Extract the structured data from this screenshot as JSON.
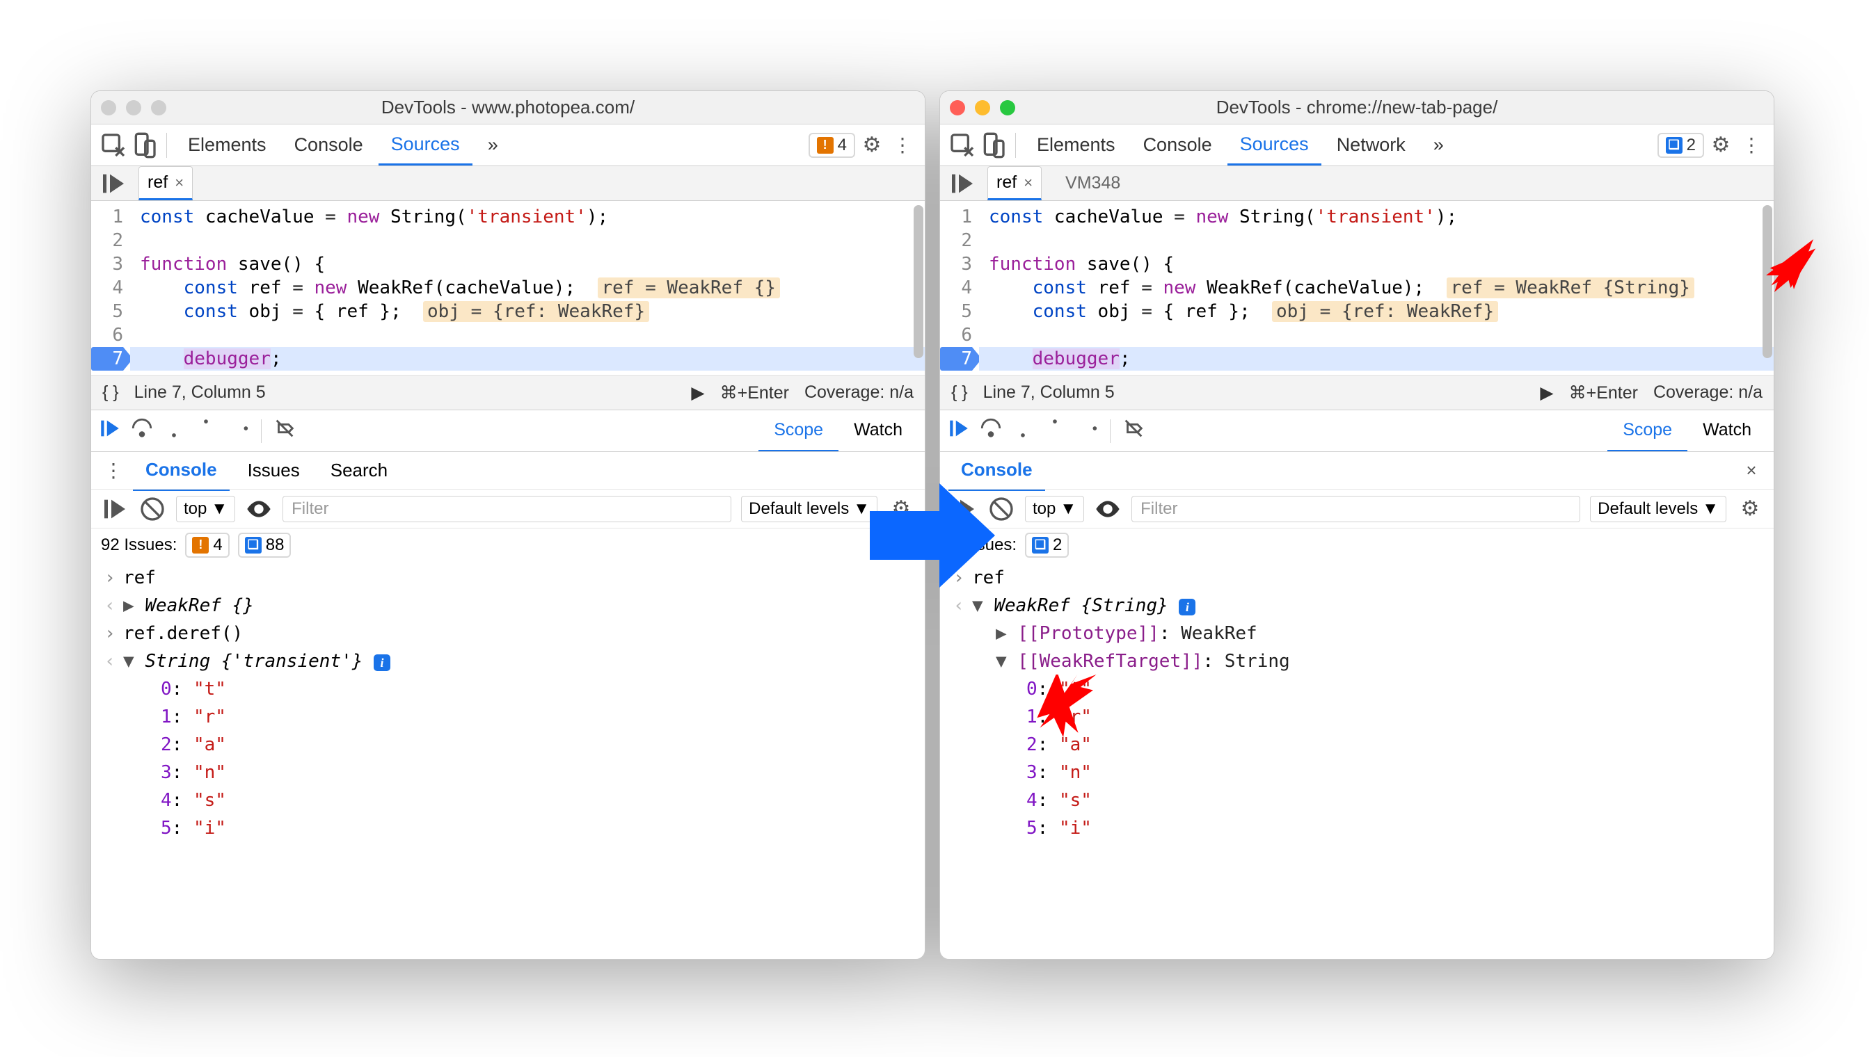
{
  "left": {
    "title": "DevTools - www.photopea.com/",
    "traffic_active": false,
    "maintabs": {
      "elements": "Elements",
      "console": "Console",
      "sources": "Sources"
    },
    "badge_warn": "4",
    "src_tab_active": "ref",
    "cursor": "Line 7, Column 5",
    "run_hint": "⌘+Enter",
    "coverage": "Coverage: n/a",
    "scope_tab": "Scope",
    "watch_tab": "Watch",
    "drawer": {
      "console": "Console",
      "issues": "Issues",
      "search": "Search"
    },
    "console_ctx": "top",
    "filter_ph": "Filter",
    "levels": "Default levels",
    "issues_label": "92 Issues:",
    "issues_warn": "4",
    "issues_info": "88",
    "log": {
      "in1": "ref",
      "out1": "WeakRef {}",
      "in2": "ref.deref()",
      "out2": "String {'transient'}",
      "chars": [
        {
          "k": "0",
          "v": "\"t\""
        },
        {
          "k": "1",
          "v": "\"r\""
        },
        {
          "k": "2",
          "v": "\"a\""
        },
        {
          "k": "3",
          "v": "\"n\""
        },
        {
          "k": "4",
          "v": "\"s\""
        },
        {
          "k": "5",
          "v": "\"i\""
        }
      ]
    },
    "code": {
      "inlay_ref": "ref = WeakRef {}",
      "inlay_obj": "obj = {ref: WeakRef}"
    }
  },
  "right": {
    "title": "DevTools - chrome://new-tab-page/",
    "traffic_active": true,
    "maintabs": {
      "elements": "Elements",
      "console": "Console",
      "sources": "Sources",
      "network": "Network"
    },
    "badge_info": "2",
    "src_tab_active": "ref",
    "src_tab_other": "VM348",
    "cursor": "Line 7, Column 5",
    "run_hint": "⌘+Enter",
    "coverage": "Coverage: n/a",
    "scope_tab": "Scope",
    "watch_tab": "Watch",
    "drawer": {
      "console": "Console"
    },
    "console_ctx": "top",
    "filter_ph": "Filter",
    "levels": "Default levels",
    "issues_label": "2 Issues:",
    "issues_info": "2",
    "log": {
      "in1": "ref",
      "out1": "WeakRef {String}",
      "proto_k": "[[Prototype]]",
      "proto_v": "WeakRef",
      "target_k": "[[WeakRefTarget]]",
      "target_v": "String",
      "chars": [
        {
          "k": "0",
          "v": "\"t\""
        },
        {
          "k": "1",
          "v": "\"r\""
        },
        {
          "k": "2",
          "v": "\"a\""
        },
        {
          "k": "3",
          "v": "\"n\""
        },
        {
          "k": "4",
          "v": "\"s\""
        },
        {
          "k": "5",
          "v": "\"i\""
        }
      ]
    },
    "code": {
      "inlay_ref": "ref = WeakRef {String}",
      "inlay_obj": "obj = {ref: WeakRef}"
    }
  },
  "shared_code": {
    "l1": [
      "const",
      " cacheValue ",
      "=",
      " ",
      "new",
      " String(",
      "'transient'",
      ");"
    ],
    "l3": [
      "function",
      " save() {"
    ],
    "l4": [
      "    ",
      "const",
      " ref ",
      "=",
      " ",
      "new",
      " WeakRef(cacheValue);"
    ],
    "l5": [
      "    ",
      "const",
      " obj ",
      "=",
      " { ref };"
    ],
    "l7": [
      "    ",
      "debugger",
      ";"
    ]
  }
}
